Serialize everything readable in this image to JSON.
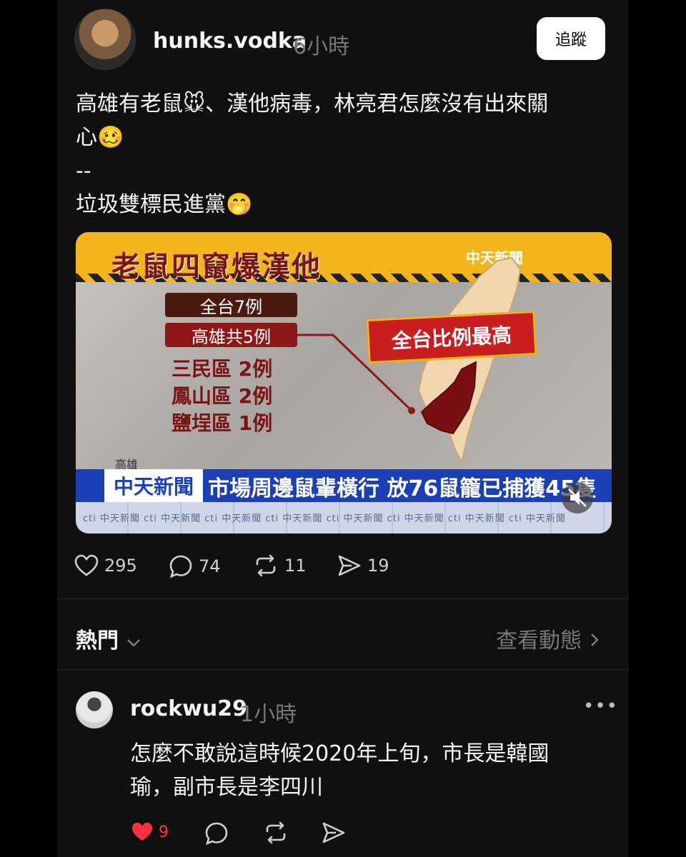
{
  "post": {
    "username": "hunks.vodka",
    "time": "6小時",
    "follow_label": "追蹤",
    "text": "高雄有老鼠🐭、漢他病毒，林亮君怎麼沒有出來關\n心🥴\n--\n垃圾雙標民進黨🤭"
  },
  "news_image": {
    "title": "老鼠四竄爆漢他",
    "channel_logo": "中天新聞",
    "total": "全台7例",
    "kaohsiung": "高雄共5例",
    "districts": [
      "三民區  2例",
      "鳳山區  2例",
      "鹽埕區  1例"
    ],
    "badge": "全台比例最高",
    "location": "高雄",
    "ticker_logo": "中天新聞",
    "ticker_text": "市場周邊鼠輩橫行 放76鼠籠已捕獲45隻",
    "ticker_small": "cti 中天新聞   cti 中天新聞   cti 中天新聞   cti 中天新聞   cti 中天新聞   cti 中天新聞   cti 中天新聞   cti 中天新聞"
  },
  "actions": {
    "likes": "295",
    "comments": "74",
    "reposts": "11",
    "shares": "19"
  },
  "section": {
    "hot_label": "熱門",
    "view_activity_label": "查看動態"
  },
  "reply": {
    "username": "rockwu29",
    "time": "1小時",
    "more_label": "•••",
    "text": "怎麼不敢說這時候2020年上旬，市長是韓國\n瑜，副市長是李四川",
    "likes": "9"
  },
  "colors": {
    "background": "#101010",
    "like_red": "#ff3040",
    "muted": "#777777"
  }
}
